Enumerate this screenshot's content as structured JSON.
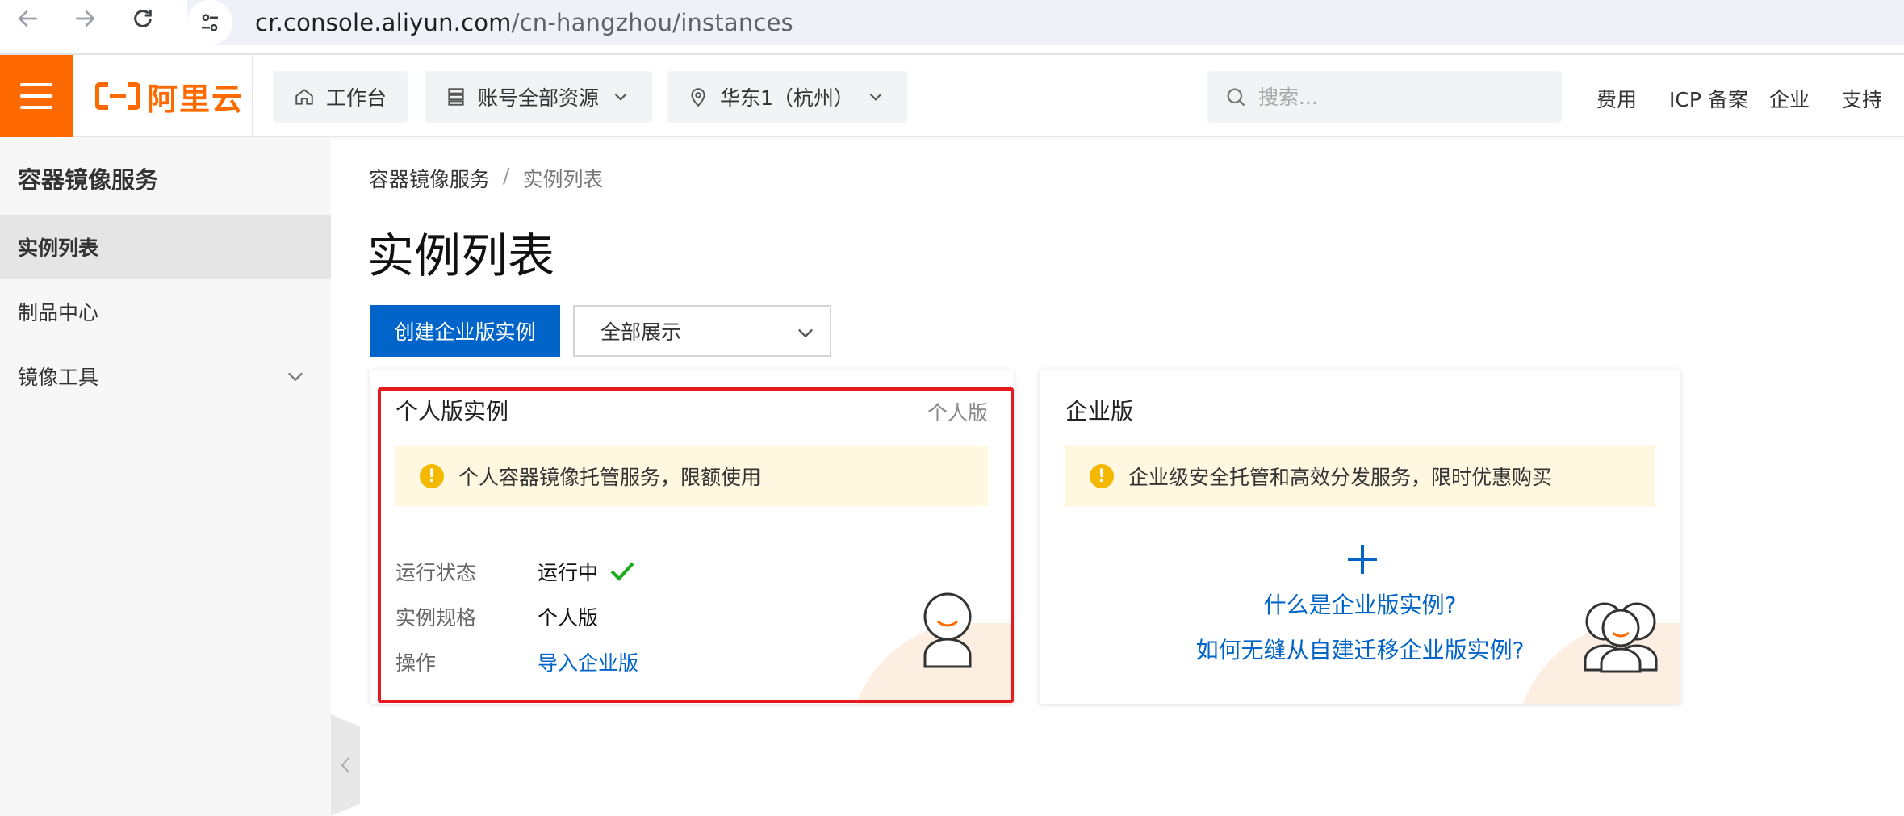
{
  "browser": {
    "url_host": "cr.console.aliyun.com",
    "url_path": "/cn-hangzhou/instances"
  },
  "topnav": {
    "logo_text": "阿里云",
    "workbench": "工作台",
    "resources": "账号全部资源",
    "region": "华东1（杭州）",
    "search_placeholder": "搜索...",
    "links": [
      "费用",
      "ICP 备案",
      "企业",
      "支持"
    ]
  },
  "sidebar": {
    "title": "容器镜像服务",
    "items": [
      {
        "label": "实例列表",
        "active": true
      },
      {
        "label": "制品中心",
        "active": false
      },
      {
        "label": "镜像工具",
        "active": false,
        "expandable": true
      }
    ]
  },
  "main": {
    "breadcrumb": [
      "容器镜像服务",
      "实例列表"
    ],
    "breadcrumb_sep": "/",
    "title": "实例列表",
    "create_button": "创建企业版实例",
    "filter_select": "全部展示",
    "personal_card": {
      "title": "个人版实例",
      "tag": "个人版",
      "notice": "个人容器镜像托管服务，限额使用",
      "rows": [
        {
          "label": "运行状态",
          "value": "运行中"
        },
        {
          "label": "实例规格",
          "value": "个人版"
        },
        {
          "label": "操作",
          "value": "导入企业版"
        }
      ]
    },
    "enterprise_card": {
      "title": "企业版",
      "notice": "企业级安全托管和高效分发服务，限时优惠购买",
      "link1": "什么是企业版实例?",
      "link2": "如何无缝从自建迁移企业版实例?"
    }
  },
  "colors": {
    "brand": "#ff6a00",
    "primary": "#0064c8",
    "highlight": "#e6191e",
    "success": "#1aad19",
    "warning": "#f5b800"
  }
}
